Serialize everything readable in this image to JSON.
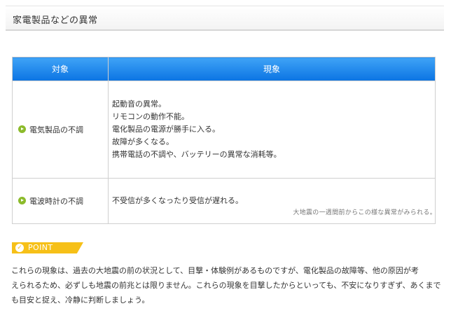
{
  "section": {
    "title": "家電製品などの異常"
  },
  "table": {
    "headers": {
      "target": "対象",
      "phenomenon": "現象"
    },
    "rows": [
      {
        "target": "電気製品の不調",
        "phenomena": [
          "起動音の異常。",
          "リモコンの動作不能。",
          "電化製品の電源が勝手に入る。",
          "故障が多くなる。",
          "携帯電話の不調や、バッテリーの異常な消耗等。"
        ]
      },
      {
        "target": "電波時計の不調",
        "phenomena": [
          "不受信が多くなったり受信が遅れる。"
        ]
      }
    ]
  },
  "note": "大地震の一週間前からこの様な異常がみられる。",
  "point": {
    "label": "POINT",
    "icon": "check-circle-icon",
    "color": "#f6c018",
    "lines": [
      "これらの現象は、過去の大地震の前の状況として、目撃・体験例があるものですが、電化製品の故障等、他の原因が考",
      "えられるため、必ずしも地震の前兆とは限りません。これらの現象を目撃したからといっても、不安になりすぎず、あくまで",
      "も目安と捉え、冷静に判断しましょう。"
    ]
  },
  "colors": {
    "header_blue": "#0b74e3",
    "bullet_green": "#8cbb2b",
    "border": "#cfcfcf"
  }
}
